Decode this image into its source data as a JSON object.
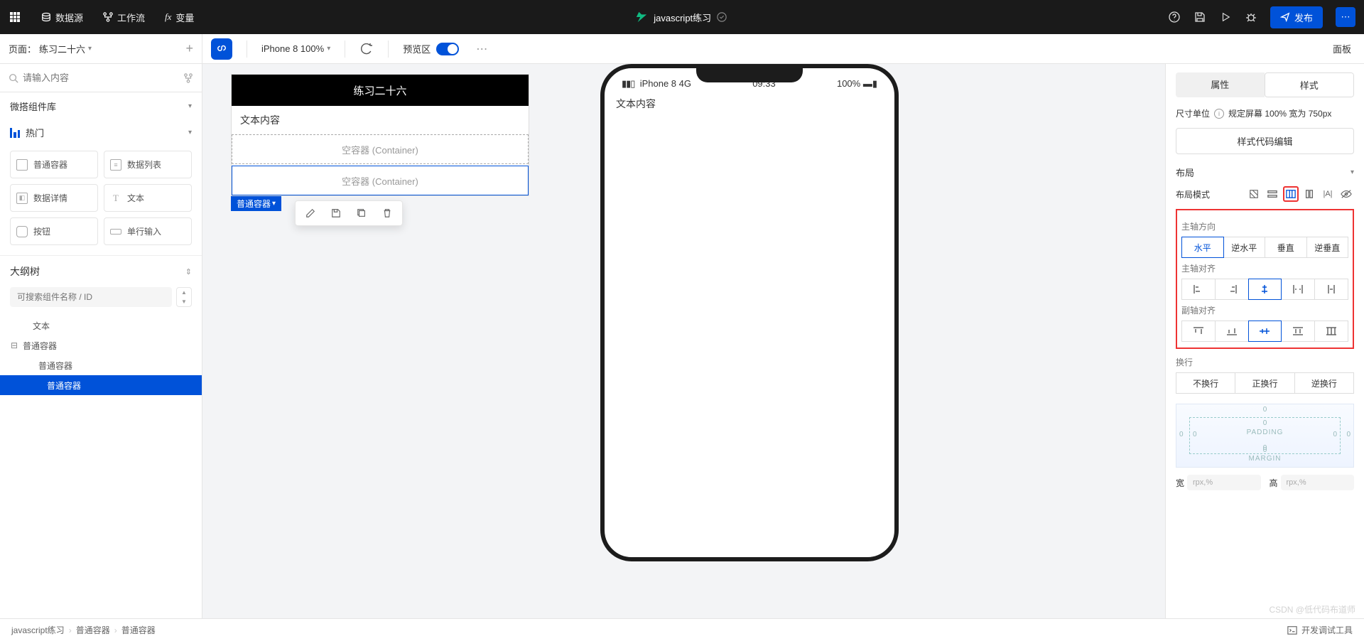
{
  "header": {
    "menu": {
      "data_source": "数据源",
      "workflow": "工作流",
      "variable": "变量"
    },
    "project_name": "javascript练习",
    "publish": "发布",
    "icons": {
      "grid": "apps-grid-icon",
      "help": "help-icon",
      "save": "save-icon",
      "play": "play-icon",
      "bug": "bug-icon"
    }
  },
  "subbar": {
    "page_label_prefix": "页面：",
    "page_name": "练习二十六",
    "device": "iPhone 8 100%",
    "preview": "预览区",
    "panel": "面板"
  },
  "left": {
    "search_placeholder": "请输入内容",
    "lib_title": "微搭组件库",
    "hot": "热门",
    "components": [
      "普通容器",
      "数据列表",
      "数据详情",
      "文本",
      "按钮",
      "单行输入"
    ],
    "outline_title": "大纲树",
    "outline_search_placeholder": "可搜索组件名称 / ID",
    "tree": {
      "n0": "文本",
      "n1": "普通容器",
      "n2": "普通容器",
      "n3": "普通容器"
    }
  },
  "canvas": {
    "page_title": "练习二十六",
    "text_content": "文本内容",
    "placeholder": "空容器 (Container)",
    "selected_tag": "普通容器",
    "actions": {
      "edit": "pencil-icon",
      "save": "save-icon",
      "copy": "copy-icon",
      "delete": "trash-icon"
    }
  },
  "phone": {
    "signal": "iPhone 8  4G",
    "time": "09:33",
    "battery": "100%",
    "text": "文本内容"
  },
  "right": {
    "tab_attr": "属性",
    "tab_style": "样式",
    "size_label": "尺寸单位",
    "size_desc": "规定屏幕 100% 宽为 750px",
    "style_code": "样式代码编辑",
    "layout_title": "布局",
    "layout_mode": "布局模式",
    "main_axis_dir": "主轴方向",
    "dirs": [
      "水平",
      "逆水平",
      "垂直",
      "逆垂直"
    ],
    "main_axis_align": "主轴对齐",
    "cross_axis_align": "副轴对齐",
    "wrap_label": "换行",
    "wraps": [
      "不换行",
      "正换行",
      "逆换行"
    ],
    "box": {
      "margin": "MARGIN",
      "padding": "PADDING",
      "zero": "0"
    },
    "width_label": "宽",
    "height_label": "高",
    "unit_ph": "rpx,%"
  },
  "bottom": {
    "crumb1": "javascript练习",
    "crumb2": "普通容器",
    "crumb3": "普通容器",
    "debug": "开发调试工具"
  },
  "watermark": "CSDN @低代码布道师"
}
